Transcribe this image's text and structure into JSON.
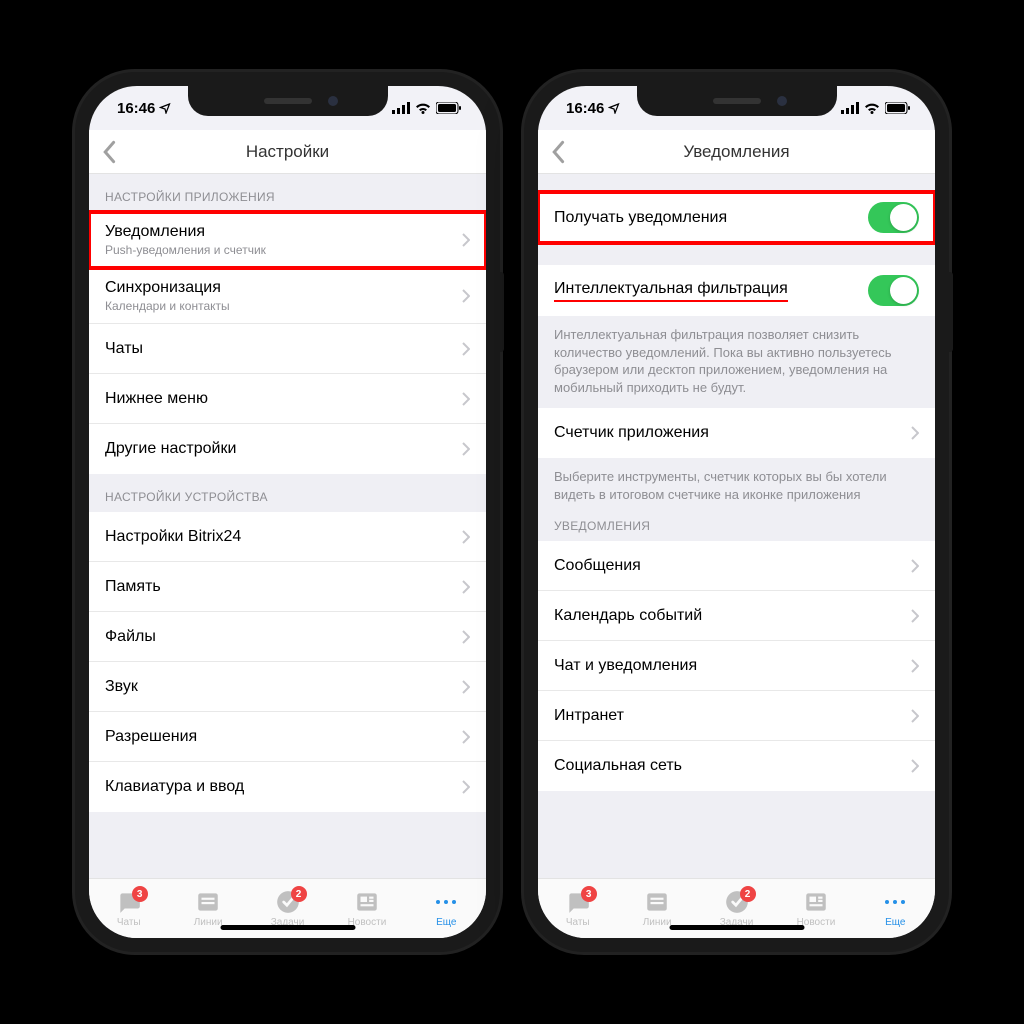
{
  "status": {
    "time": "16:46"
  },
  "left": {
    "title": "Настройки",
    "sec1_header": "НАСТРОЙКИ ПРИЛОЖЕНИЯ",
    "rows1": [
      {
        "t": "Уведомления",
        "s": "Push-уведомления и счетчик"
      },
      {
        "t": "Синхронизация",
        "s": "Календари и контакты"
      },
      {
        "t": "Чаты",
        "s": ""
      },
      {
        "t": "Нижнее меню",
        "s": ""
      },
      {
        "t": "Другие настройки",
        "s": ""
      }
    ],
    "sec2_header": "НАСТРОЙКИ УСТРОЙСТВА",
    "rows2": [
      {
        "t": "Настройки Bitrix24"
      },
      {
        "t": "Память"
      },
      {
        "t": "Файлы"
      },
      {
        "t": "Звук"
      },
      {
        "t": "Разрешения"
      },
      {
        "t": "Клавиатура и ввод"
      }
    ]
  },
  "right": {
    "title": "Уведомления",
    "row_toggle1": "Получать уведомления",
    "row_toggle2": "Интеллектуальная фильтрация",
    "note1": "Интеллектуальная фильтрация позволяет снизить количество уведомлений. Пока вы активно пользуетесь браузером или десктоп приложением, уведомления на мобильный приходить не будут.",
    "row_counter": "Счетчик приложения",
    "note2": "Выберите инструменты, счетчик которых вы бы хотели видеть в итоговом счетчике на иконке приложения",
    "sec_header": "УВЕДОМЛЕНИЯ",
    "rows": [
      "Сообщения",
      "Календарь событий",
      "Чат и уведомления",
      "Интранет",
      "Социальная сеть"
    ]
  },
  "tabs": [
    {
      "l": "Чаты",
      "b": "3"
    },
    {
      "l": "Линии",
      "b": ""
    },
    {
      "l": "Задачи",
      "b": "2"
    },
    {
      "l": "Новости",
      "b": ""
    },
    {
      "l": "Еще",
      "b": ""
    }
  ]
}
